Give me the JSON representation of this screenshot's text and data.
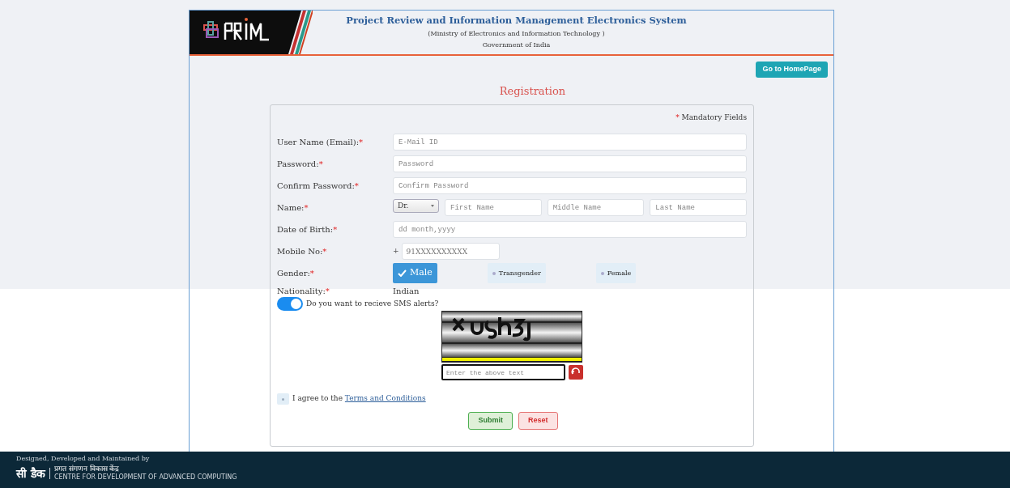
{
  "header": {
    "title": "Project Review and Information Management Electronics System",
    "subtitle": "(Ministry of Electronics and Information Technology )",
    "government": "Government of India",
    "home_button": "Go to HomePage"
  },
  "form": {
    "title": "Registration",
    "mandatory_note": "Mandatory Fields",
    "required_mark": "*",
    "fields": [
      {
        "kind": "text",
        "label": "User Name (Email):",
        "placeholder": "E-Mail ID"
      },
      {
        "kind": "text",
        "label": "Password:",
        "placeholder": "Password"
      },
      {
        "kind": "text",
        "label": "Confirm Password:",
        "placeholder": "Confirm Password"
      },
      {
        "kind": "name",
        "label": "Name:",
        "title_value": "Dr.",
        "placeholders": [
          "First Name",
          "Middle Name",
          "Last Name"
        ]
      },
      {
        "kind": "text",
        "label": "Date of Birth:",
        "placeholder": "dd month,yyyy"
      },
      {
        "kind": "mobile",
        "label": "Mobile No:",
        "prefix": "+",
        "placeholder": "91XXXXXXXXXX"
      },
      {
        "kind": "gender",
        "label": "Gender:",
        "options": [
          {
            "label": "Male",
            "selected": true
          },
          {
            "label": "Transgender",
            "selected": false
          },
          {
            "label": "Female",
            "selected": false
          }
        ]
      },
      {
        "kind": "static",
        "label": "Nationality:",
        "value": "Indian"
      }
    ],
    "sms_alerts": {
      "label": "Do you want to recieve SMS alerts?",
      "on": true
    },
    "captcha": {
      "placeholder": "Enter the above text"
    },
    "terms": {
      "checked": false,
      "text": "I agree to the ",
      "link": "Terms and Conditions"
    },
    "buttons": [
      {
        "kind": "submit",
        "label": "Submit"
      },
      {
        "kind": "reset",
        "label": "Reset"
      }
    ]
  },
  "footer": {
    "credit": "Designed, Developed and Maintained by",
    "logo_hindi": "सी डैक",
    "org_hindi": "प्रगत संगणन विकास केंद्र",
    "org_english": "CENTRE FOR DEVELOPMENT OF ADVANCED COMPUTING"
  }
}
